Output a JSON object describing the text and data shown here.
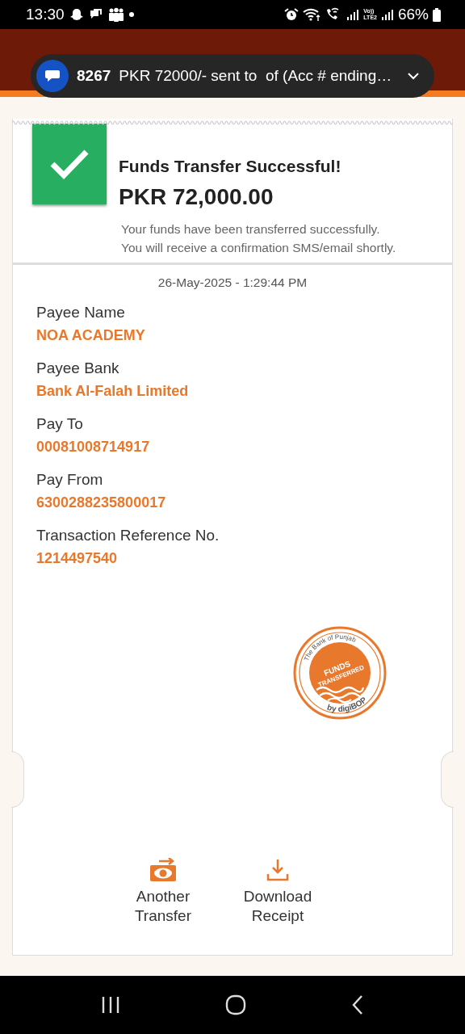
{
  "status_bar": {
    "time": "13:30",
    "network_badge": [
      "Vo))",
      "LTE2"
    ],
    "battery": "66%"
  },
  "notification": {
    "sender": "8267",
    "message": "PKR 72000/- sent to  of (Acc # ending…"
  },
  "receipt": {
    "title": "Funds Transfer Successful!",
    "amount": "PKR 72,000.00",
    "message": "Your funds have been transferred successfully.\nYou will receive a confirmation SMS/email shortly.",
    "date": "26-May-2025 - 1:29:44 PM",
    "fields": [
      {
        "label": "Payee Name",
        "value": "NOA ACADEMY"
      },
      {
        "label": "Payee Bank",
        "value": "Bank Al-Falah Limited"
      },
      {
        "label": "Pay To",
        "value": "00081008714917"
      },
      {
        "label": "Pay From",
        "value": "6300288235800017"
      },
      {
        "label": "Transaction Reference No.",
        "value": "1214497540"
      }
    ],
    "stamp": {
      "arc_text": "The Bank of Punjab",
      "center_text": [
        "FUNDS",
        "TRANSFERRED"
      ],
      "footer": "by digiBOP"
    },
    "actions": [
      {
        "kind": "transfer",
        "label": "Another Transfer"
      },
      {
        "kind": "download",
        "label": "Download Receipt"
      }
    ]
  }
}
